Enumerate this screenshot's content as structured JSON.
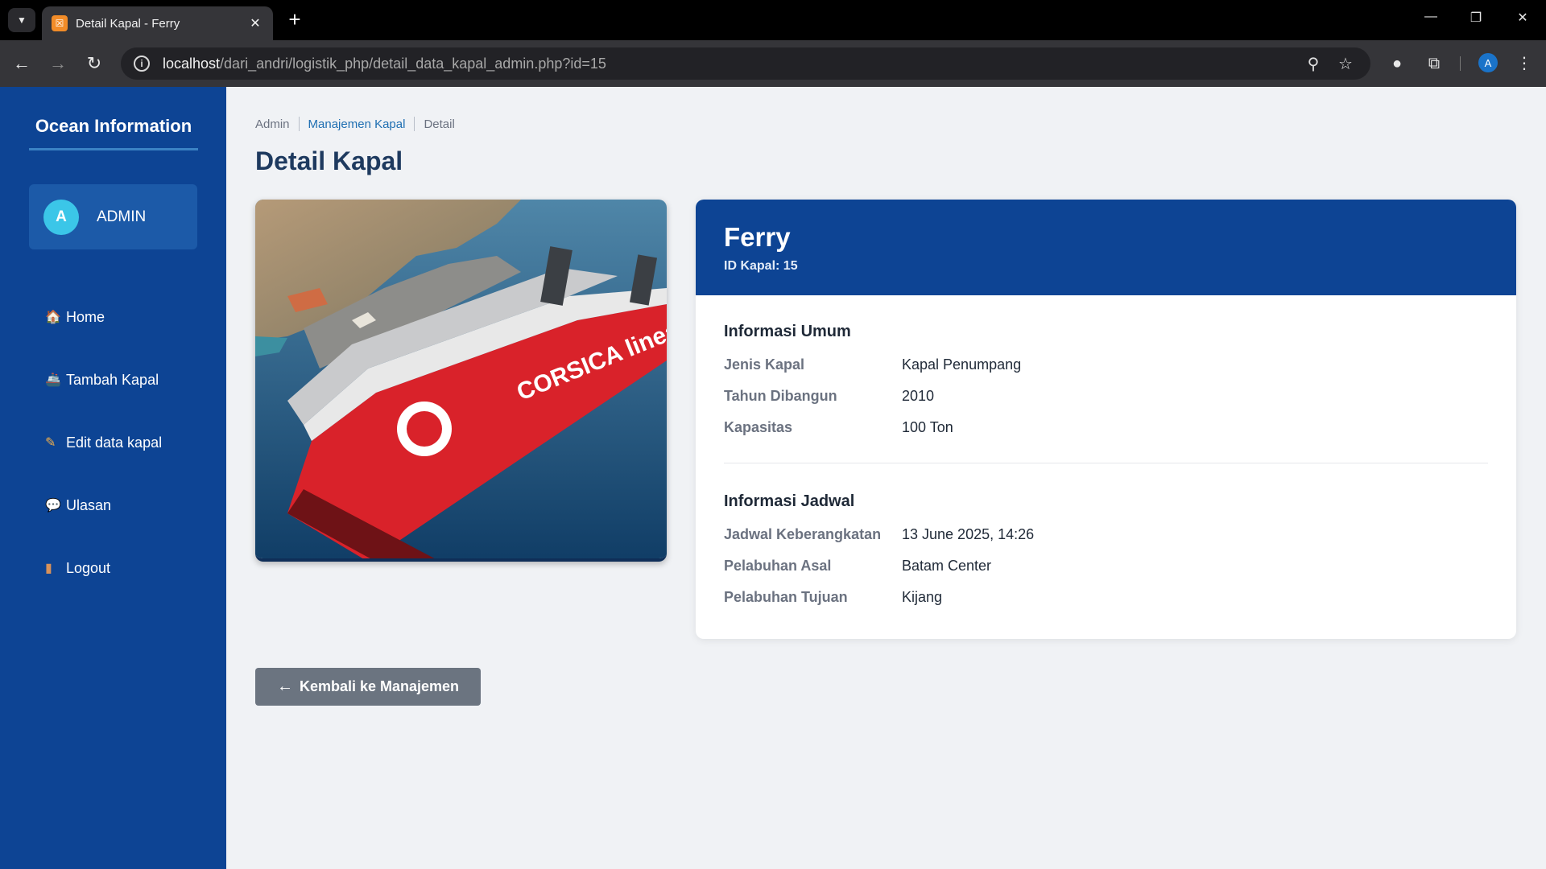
{
  "browser": {
    "tab_title": "Detail Kapal - Ferry",
    "favicon_glyph": "☒",
    "url_host": "localhost",
    "url_path": "/dari_andri/logistik_php/detail_data_kapal_admin.php?id=15",
    "profile_initial": "A"
  },
  "sidebar": {
    "brand": "Ocean Information",
    "user": {
      "initial": "A",
      "name": "ADMIN"
    },
    "items": [
      {
        "label": "Home",
        "icon": "home-icon",
        "glyph": "🏠"
      },
      {
        "label": "Tambah Kapal",
        "icon": "ship-icon",
        "glyph": "🚢"
      },
      {
        "label": "Edit data kapal",
        "icon": "pencil-icon",
        "glyph": "✎"
      },
      {
        "label": "Ulasan",
        "icon": "speech-bubble-icon",
        "glyph": "💬"
      },
      {
        "label": "Logout",
        "icon": "door-icon",
        "glyph": "▮"
      }
    ]
  },
  "breadcrumb": [
    "Admin",
    "Manajemen Kapal",
    "Detail"
  ],
  "page_title": "Detail Kapal",
  "ship": {
    "name": "Ferry",
    "id_label": "ID Kapal: 15"
  },
  "general_info": {
    "title": "Informasi Umum",
    "rows": [
      {
        "label": "Jenis Kapal",
        "value": "Kapal Penumpang"
      },
      {
        "label": "Tahun Dibangun",
        "value": "2010"
      },
      {
        "label": "Kapasitas",
        "value": "100 Ton"
      }
    ]
  },
  "schedule_info": {
    "title": "Informasi Jadwal",
    "rows": [
      {
        "label": "Jadwal Keberangkatan",
        "value": "13 June 2025, 14:26"
      },
      {
        "label": "Pelabuhan Asal",
        "value": "Batam Center"
      },
      {
        "label": "Pelabuhan Tujuan",
        "value": "Kijang"
      }
    ]
  },
  "photo_text": "CORSICA linea",
  "back_button": "Kembali ke Manajemen",
  "colors": {
    "sidebar": "#0d4494",
    "header": "#0d4494",
    "button": "#6b7480",
    "link": "#1f6fb2"
  }
}
